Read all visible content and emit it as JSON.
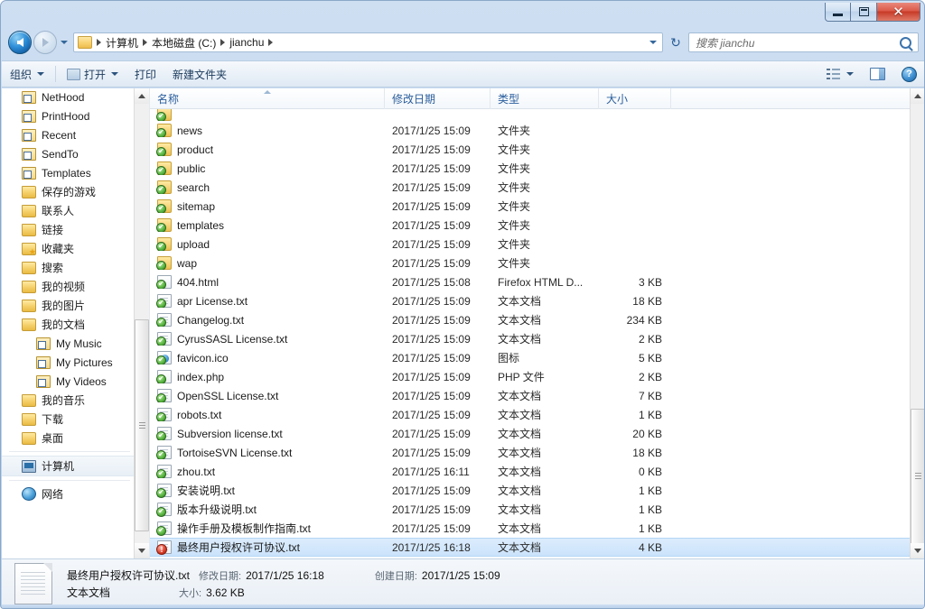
{
  "window": {
    "controls": {
      "minimize": "–",
      "maximize": "□",
      "close": "✕"
    }
  },
  "addressbar": {
    "back_tooltip": "后退",
    "forward_tooltip": "前进",
    "breadcrumbs": [
      "计算机",
      "本地磁盘 (C:)",
      "jianchu"
    ],
    "refresh_label": "↻"
  },
  "search": {
    "placeholder": "搜索 jianchu",
    "value": ""
  },
  "toolbar": {
    "organize": "组织",
    "open": "打开",
    "print": "打印",
    "new_folder": "新建文件夹",
    "help_label": "?"
  },
  "navpane": {
    "items": [
      {
        "label": "NetHood",
        "icon": "shortcut-icon",
        "indent": 0
      },
      {
        "label": "PrintHood",
        "icon": "shortcut-icon",
        "indent": 0
      },
      {
        "label": "Recent",
        "icon": "shortcut-icon",
        "indent": 0
      },
      {
        "label": "SendTo",
        "icon": "shortcut-icon",
        "indent": 0
      },
      {
        "label": "Templates",
        "icon": "shortcut-icon",
        "indent": 0
      },
      {
        "label": "保存的游戏",
        "icon": "folder-icon",
        "indent": 0
      },
      {
        "label": "联系人",
        "icon": "folder-icon",
        "indent": 0
      },
      {
        "label": "链接",
        "icon": "folder-icon",
        "indent": 0
      },
      {
        "label": "收藏夹",
        "icon": "folder-star-icon",
        "indent": 0
      },
      {
        "label": "搜索",
        "icon": "folder-icon",
        "indent": 0
      },
      {
        "label": "我的视频",
        "icon": "folder-icon",
        "indent": 0
      },
      {
        "label": "我的图片",
        "icon": "folder-icon",
        "indent": 0
      },
      {
        "label": "我的文档",
        "icon": "folder-icon",
        "indent": 0
      },
      {
        "label": "My Music",
        "icon": "shortcut-icon",
        "indent": 1
      },
      {
        "label": "My Pictures",
        "icon": "shortcut-icon",
        "indent": 1
      },
      {
        "label": "My Videos",
        "icon": "shortcut-icon",
        "indent": 1
      },
      {
        "label": "我的音乐",
        "icon": "folder-icon",
        "indent": 0
      },
      {
        "label": "下载",
        "icon": "folder-icon",
        "indent": 0
      },
      {
        "label": "桌面",
        "icon": "folder-icon",
        "indent": 0
      }
    ],
    "computer": {
      "label": "计算机",
      "icon": "computer-icon"
    },
    "network": {
      "label": "网络",
      "icon": "network-icon"
    }
  },
  "filelist": {
    "columns": [
      {
        "key": "name",
        "label": "名称",
        "sorted": true
      },
      {
        "key": "date",
        "label": "修改日期",
        "sorted": false
      },
      {
        "key": "type",
        "label": "类型",
        "sorted": false
      },
      {
        "key": "size",
        "label": "大小",
        "sorted": false
      }
    ],
    "rows": [
      {
        "name": "news",
        "date": "2017/1/25 15:09",
        "type": "文件夹",
        "size": "",
        "icon": "folder-icon",
        "overlay": "check",
        "selected": false
      },
      {
        "name": "product",
        "date": "2017/1/25 15:09",
        "type": "文件夹",
        "size": "",
        "icon": "folder-icon",
        "overlay": "check",
        "selected": false
      },
      {
        "name": "public",
        "date": "2017/1/25 15:09",
        "type": "文件夹",
        "size": "",
        "icon": "folder-icon",
        "overlay": "check",
        "selected": false
      },
      {
        "name": "search",
        "date": "2017/1/25 15:09",
        "type": "文件夹",
        "size": "",
        "icon": "folder-icon",
        "overlay": "check",
        "selected": false
      },
      {
        "name": "sitemap",
        "date": "2017/1/25 15:09",
        "type": "文件夹",
        "size": "",
        "icon": "folder-icon",
        "overlay": "check",
        "selected": false
      },
      {
        "name": "templates",
        "date": "2017/1/25 15:09",
        "type": "文件夹",
        "size": "",
        "icon": "folder-icon",
        "overlay": "check",
        "selected": false
      },
      {
        "name": "upload",
        "date": "2017/1/25 15:09",
        "type": "文件夹",
        "size": "",
        "icon": "folder-icon",
        "overlay": "check",
        "selected": false
      },
      {
        "name": "wap",
        "date": "2017/1/25 15:09",
        "type": "文件夹",
        "size": "",
        "icon": "folder-icon",
        "overlay": "check",
        "selected": false
      },
      {
        "name": "404.html",
        "date": "2017/1/25 15:08",
        "type": "Firefox HTML D...",
        "size": "3 KB",
        "icon": "html-icon",
        "overlay": "check",
        "selected": false
      },
      {
        "name": "apr License.txt",
        "date": "2017/1/25 15:09",
        "type": "文本文档",
        "size": "18 KB",
        "icon": "doc-icon",
        "overlay": "check",
        "selected": false
      },
      {
        "name": "Changelog.txt",
        "date": "2017/1/25 15:09",
        "type": "文本文档",
        "size": "234 KB",
        "icon": "doc-icon",
        "overlay": "check",
        "selected": false
      },
      {
        "name": "CyrusSASL License.txt",
        "date": "2017/1/25 15:09",
        "type": "文本文档",
        "size": "2 KB",
        "icon": "doc-icon",
        "overlay": "check",
        "selected": false
      },
      {
        "name": "favicon.ico",
        "date": "2017/1/25 15:09",
        "type": "图标",
        "size": "5 KB",
        "icon": "ico-icon",
        "overlay": "check",
        "selected": false
      },
      {
        "name": "index.php",
        "date": "2017/1/25 15:09",
        "type": "PHP 文件",
        "size": "2 KB",
        "icon": "php-icon",
        "overlay": "check",
        "selected": false
      },
      {
        "name": "OpenSSL License.txt",
        "date": "2017/1/25 15:09",
        "type": "文本文档",
        "size": "7 KB",
        "icon": "doc-icon",
        "overlay": "check",
        "selected": false
      },
      {
        "name": "robots.txt",
        "date": "2017/1/25 15:09",
        "type": "文本文档",
        "size": "1 KB",
        "icon": "doc-icon",
        "overlay": "check",
        "selected": false
      },
      {
        "name": "Subversion license.txt",
        "date": "2017/1/25 15:09",
        "type": "文本文档",
        "size": "20 KB",
        "icon": "doc-icon",
        "overlay": "check",
        "selected": false
      },
      {
        "name": "TortoiseSVN License.txt",
        "date": "2017/1/25 15:09",
        "type": "文本文档",
        "size": "18 KB",
        "icon": "doc-icon",
        "overlay": "check",
        "selected": false
      },
      {
        "name": "zhou.txt",
        "date": "2017/1/25 16:11",
        "type": "文本文档",
        "size": "0 KB",
        "icon": "doc-icon",
        "overlay": "check",
        "selected": false
      },
      {
        "name": "安装说明.txt",
        "date": "2017/1/25 15:09",
        "type": "文本文档",
        "size": "1 KB",
        "icon": "doc-icon",
        "overlay": "check",
        "selected": false
      },
      {
        "name": "版本升级说明.txt",
        "date": "2017/1/25 15:09",
        "type": "文本文档",
        "size": "1 KB",
        "icon": "doc-icon",
        "overlay": "check",
        "selected": false
      },
      {
        "name": "操作手册及模板制作指南.txt",
        "date": "2017/1/25 15:09",
        "type": "文本文档",
        "size": "1 KB",
        "icon": "doc-icon",
        "overlay": "check",
        "selected": false
      },
      {
        "name": "最终用户授权许可协议.txt",
        "date": "2017/1/25 16:18",
        "type": "文本文档",
        "size": "4 KB",
        "icon": "doc-icon",
        "overlay": "alert",
        "selected": true
      }
    ]
  },
  "details": {
    "filename": "最终用户授权许可协议.txt",
    "modified_label": "修改日期:",
    "modified_value": "2017/1/25 16:18",
    "created_label": "创建日期:",
    "created_value": "2017/1/25 15:09",
    "filetype": "文本文档",
    "size_label": "大小:",
    "size_value": "3.62 KB"
  },
  "colors": {
    "accent": "#2a5d9c",
    "selection": "#cbe3fb",
    "close_button": "#c73a27",
    "folder": "#f4cf69",
    "overlay_ok": "#56b23e",
    "overlay_alert": "#d93b25"
  }
}
